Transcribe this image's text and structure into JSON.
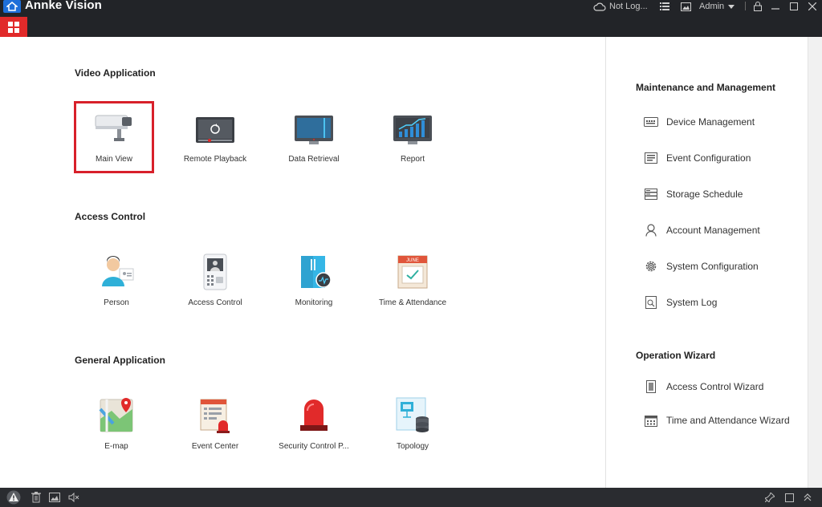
{
  "titlebar": {
    "app_title": "Annke Vision",
    "cloud_status": "Not Log...",
    "user_name": "Admin"
  },
  "sections": {
    "video": {
      "title": "Video Application",
      "tiles": [
        {
          "label": "Main View",
          "icon": "camera-icon",
          "selected": true
        },
        {
          "label": "Remote Playback",
          "icon": "playback-icon"
        },
        {
          "label": "Data Retrieval",
          "icon": "monitor-icon"
        },
        {
          "label": "Report",
          "icon": "report-chart-icon"
        }
      ]
    },
    "access": {
      "title": "Access Control",
      "tiles": [
        {
          "label": "Person",
          "icon": "person-icon"
        },
        {
          "label": "Access Control",
          "icon": "access-terminal-icon"
        },
        {
          "label": "Monitoring",
          "icon": "door-monitor-icon"
        },
        {
          "label": "Time & Attendance",
          "icon": "calendar-icon"
        }
      ]
    },
    "general": {
      "title": "General Application",
      "tiles": [
        {
          "label": "E-map",
          "icon": "map-icon"
        },
        {
          "label": "Event Center",
          "icon": "event-center-icon"
        },
        {
          "label": "Security Control P...",
          "icon": "alarm-light-icon"
        },
        {
          "label": "Topology",
          "icon": "topology-icon"
        }
      ]
    }
  },
  "right_panel": {
    "maintenance": {
      "title": "Maintenance and Management",
      "items": [
        {
          "label": "Device Management",
          "icon": "device-icon"
        },
        {
          "label": "Event Configuration",
          "icon": "event-config-icon"
        },
        {
          "label": "Storage Schedule",
          "icon": "storage-icon"
        },
        {
          "label": "Account Management",
          "icon": "account-icon"
        },
        {
          "label": "System Configuration",
          "icon": "gear-icon"
        },
        {
          "label": "System Log",
          "icon": "log-icon"
        }
      ]
    },
    "wizard": {
      "title": "Operation Wizard",
      "items": [
        {
          "label": "Access Control Wizard",
          "icon": "door-icon"
        },
        {
          "label": "Time and Attendance Wizard",
          "icon": "calendar-grid-icon"
        }
      ]
    }
  },
  "colors": {
    "accent_red": "#e12a2a",
    "titlebar_bg": "#222428",
    "selection_red": "#d8202a"
  }
}
